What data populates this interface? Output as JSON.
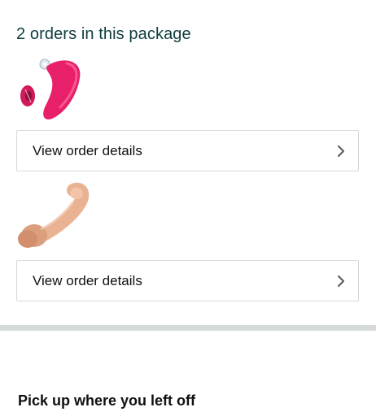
{
  "package": {
    "title": "2 orders in this package",
    "orders": [
      {
        "action_label": "View order details",
        "thumbnail_icon": "pink-product-icon"
      },
      {
        "action_label": "View order details",
        "thumbnail_icon": "beige-product-icon"
      }
    ]
  },
  "next_section": {
    "title": "Pick up where you left off"
  },
  "colors": {
    "title_text": "#0f3d3e",
    "border": "#d5d9d9",
    "divider": "#d5d9d9",
    "product_1": "#e8206a",
    "product_2": "#e9b393"
  }
}
